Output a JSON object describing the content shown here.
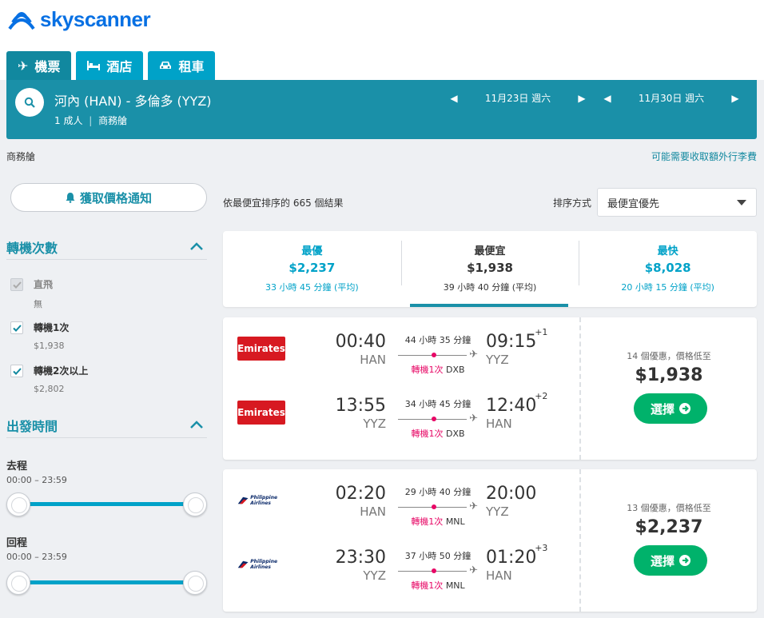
{
  "brand": {
    "name": "skyscanner"
  },
  "tabs": [
    {
      "label": "機票",
      "icon": "plane-icon"
    },
    {
      "label": "酒店",
      "icon": "bed-icon"
    },
    {
      "label": "租車",
      "icon": "car-icon"
    }
  ],
  "search": {
    "route": "河內 (HAN) - 多倫多 (YYZ)",
    "passengers": "1 成人",
    "cabin": "商務艙",
    "outbound_date": "11月23日 週六",
    "return_date": "11月30日 週六"
  },
  "subbar": {
    "cabin": "商務艙",
    "baggage_note": "可能需要收取額外行李費"
  },
  "price_alert": {
    "label": "獲取價格通知"
  },
  "filters": {
    "stops": {
      "title": "轉機次數",
      "items": [
        {
          "label": "直飛",
          "sub": "無",
          "checked": true,
          "disabled": true
        },
        {
          "label": "轉機1次",
          "sub": "$1,938",
          "checked": true,
          "disabled": false
        },
        {
          "label": "轉機2次以上",
          "sub": "$2,802",
          "checked": true,
          "disabled": false
        }
      ]
    },
    "times": {
      "title": "出發時間",
      "outbound": {
        "label": "去程",
        "range": "00:00 – 23:59"
      },
      "return": {
        "label": "回程",
        "range": "00:00 – 23:59"
      }
    }
  },
  "results": {
    "info": "依最便宜排序的 665 個結果",
    "sort_label": "排序方式",
    "sort_value": "最便宜優先"
  },
  "summary": [
    {
      "title": "最優",
      "price": "$2,237",
      "duration": "33 小時 45 分鐘 (平均)"
    },
    {
      "title": "最便宜",
      "price": "$1,938",
      "duration": "39 小時 40 分鐘 (平均)"
    },
    {
      "title": "最快",
      "price": "$8,028",
      "duration": "20 小時 15 分鐘 (平均)"
    }
  ],
  "cards": [
    {
      "airline": "Emirates",
      "deals": "14 個優惠，價格低至",
      "price": "$1,938",
      "select": "選擇",
      "legs": [
        {
          "dep_time": "00:40",
          "dep_ap": "HAN",
          "duration": "44 小時 35 分鐘",
          "stops": "轉機1次",
          "via": "DXB",
          "arr_time": "09:15",
          "arr_ap": "YYZ",
          "plus": "+1"
        },
        {
          "dep_time": "13:55",
          "dep_ap": "YYZ",
          "duration": "34 小時 45 分鐘",
          "stops": "轉機1次",
          "via": "DXB",
          "arr_time": "12:40",
          "arr_ap": "HAN",
          "plus": "+2"
        }
      ]
    },
    {
      "airline": "Philippine Airlines",
      "deals": "13 個優惠，價格低至",
      "price": "$2,237",
      "select": "選擇",
      "legs": [
        {
          "dep_time": "02:20",
          "dep_ap": "HAN",
          "duration": "29 小時 40 分鐘",
          "stops": "轉機1次",
          "via": "MNL",
          "arr_time": "20:00",
          "arr_ap": "YYZ",
          "plus": ""
        },
        {
          "dep_time": "23:30",
          "dep_ap": "YYZ",
          "duration": "37 小時 50 分鐘",
          "stops": "轉機1次",
          "via": "MNL",
          "arr_time": "01:20",
          "arr_ap": "HAN",
          "plus": "+3"
        }
      ]
    }
  ]
}
